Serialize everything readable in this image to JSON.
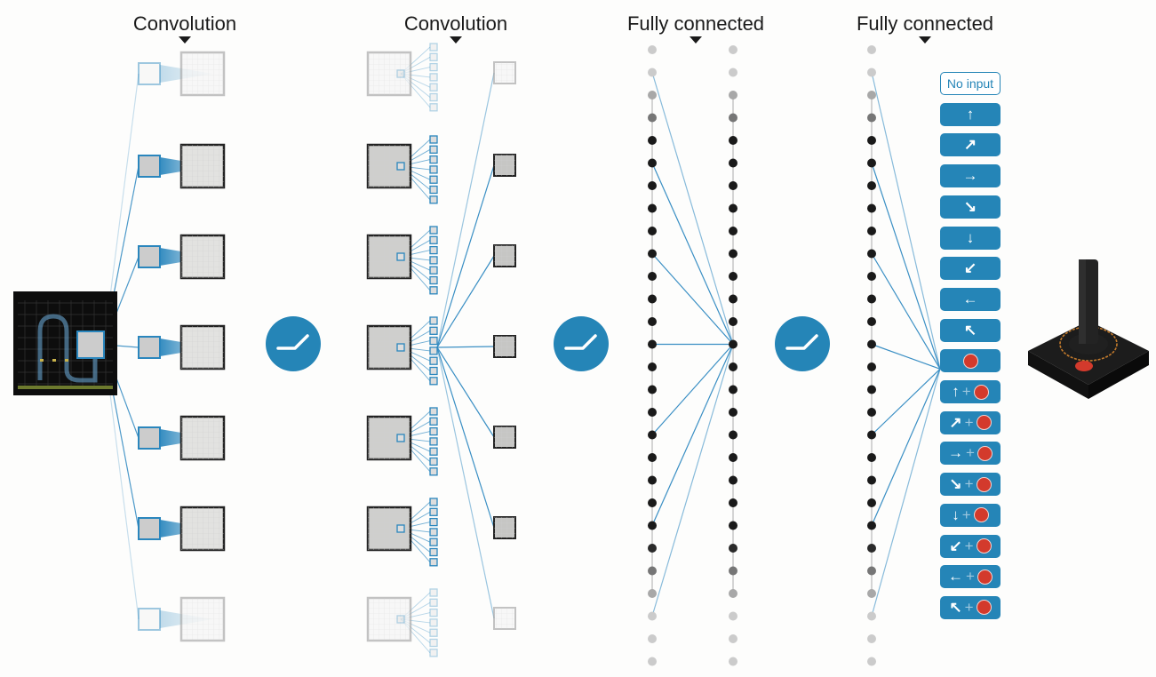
{
  "stages": [
    {
      "title": "Convolution"
    },
    {
      "title": "Convolution"
    },
    {
      "title": "Fully connected"
    },
    {
      "title": "Fully connected"
    }
  ],
  "activations": [
    "relu",
    "relu",
    "relu"
  ],
  "actions": [
    {
      "label": "No input",
      "arrow": "",
      "fire": false
    },
    {
      "label": "",
      "arrow": "↑",
      "fire": false
    },
    {
      "label": "",
      "arrow": "↗",
      "fire": false
    },
    {
      "label": "",
      "arrow": "→",
      "fire": false
    },
    {
      "label": "",
      "arrow": "↘",
      "fire": false
    },
    {
      "label": "",
      "arrow": "↓",
      "fire": false
    },
    {
      "label": "",
      "arrow": "↙",
      "fire": false
    },
    {
      "label": "",
      "arrow": "←",
      "fire": false
    },
    {
      "label": "",
      "arrow": "↖",
      "fire": false
    },
    {
      "label": "",
      "arrow": "",
      "fire": true
    },
    {
      "label": "",
      "arrow": "↑",
      "fire": true,
      "plus": "+"
    },
    {
      "label": "",
      "arrow": "↗",
      "fire": true,
      "plus": "+"
    },
    {
      "label": "",
      "arrow": "→",
      "fire": true,
      "plus": "+"
    },
    {
      "label": "",
      "arrow": "↘",
      "fire": true,
      "plus": "+"
    },
    {
      "label": "",
      "arrow": "↓",
      "fire": true,
      "plus": "+"
    },
    {
      "label": "",
      "arrow": "↙",
      "fire": true,
      "plus": "+"
    },
    {
      "label": "",
      "arrow": "←",
      "fire": true,
      "plus": "+"
    },
    {
      "label": "",
      "arrow": "↖",
      "fire": true,
      "plus": "+"
    }
  ],
  "highlighted_action": 9,
  "colors": {
    "accent": "#2585b7",
    "line": "#3a8fc4",
    "fire": "#d33a2c",
    "node_dark": "#1a1a1a",
    "node_faded": "#cccccc"
  },
  "conv1": {
    "feature_maps": 7
  },
  "conv2": {
    "feature_maps": 7,
    "kernels_per_map": 7
  },
  "fc1": {
    "nodes": 28
  },
  "fc2": {
    "nodes": 28
  },
  "controller": {
    "icon": "joystick-icon"
  }
}
